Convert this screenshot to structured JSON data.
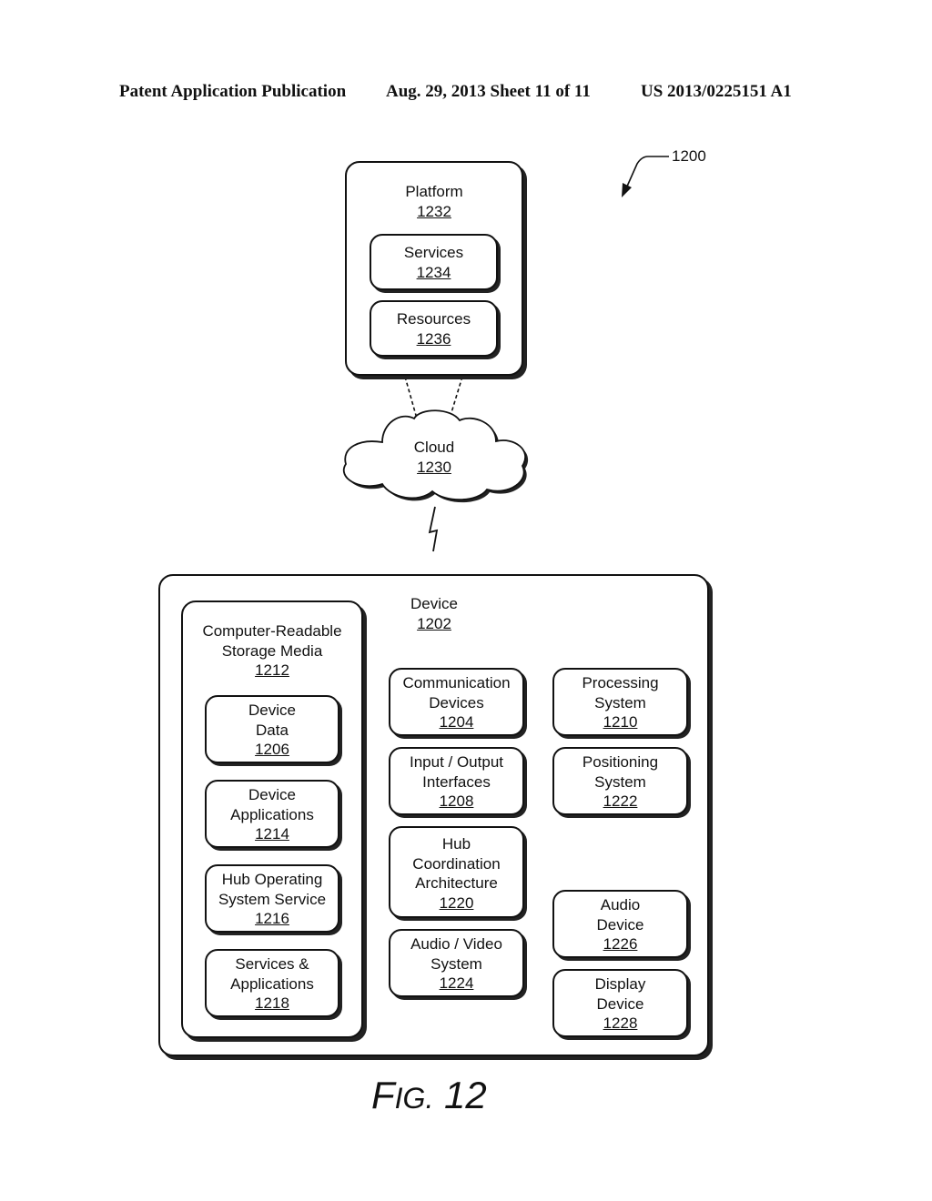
{
  "header": {
    "left": "Patent Application Publication",
    "date_sheet": "Aug. 29, 2013  Sheet 11 of 11",
    "patent_number": "US 2013/0225151 A1"
  },
  "figure_ref": "1200",
  "figure_caption": {
    "prefix": "F",
    "small": "IG.",
    "number": "12"
  },
  "platform": {
    "label": "Platform",
    "ref": "1232",
    "children": [
      {
        "label": "Services",
        "ref": "1234"
      },
      {
        "label": "Resources",
        "ref": "1236"
      }
    ]
  },
  "cloud": {
    "label": "Cloud",
    "ref": "1230"
  },
  "device": {
    "label": "Device",
    "ref": "1202",
    "storage": {
      "label": "Computer-Readable\nStorage Media",
      "ref": "1212",
      "children": [
        {
          "label": "Device\nData",
          "ref": "1206"
        },
        {
          "label": "Device\nApplications",
          "ref": "1214"
        },
        {
          "label": "Hub Operating\nSystem Service",
          "ref": "1216"
        },
        {
          "label": "Services &\nApplications",
          "ref": "1218"
        }
      ]
    },
    "components": {
      "communication": {
        "label": "Communication\nDevices",
        "ref": "1204"
      },
      "processing": {
        "label": "Processing\nSystem",
        "ref": "1210"
      },
      "io": {
        "label": "Input / Output\nInterfaces",
        "ref": "1208"
      },
      "positioning": {
        "label": "Positioning\nSystem",
        "ref": "1222"
      },
      "hub": {
        "label": "Hub\nCoordination\nArchitecture",
        "ref": "1220"
      },
      "av": {
        "label": "Audio / Video\nSystem",
        "ref": "1224"
      },
      "audio": {
        "label": "Audio\nDevice",
        "ref": "1226"
      },
      "display": {
        "label": "Display\nDevice",
        "ref": "1228"
      }
    }
  }
}
